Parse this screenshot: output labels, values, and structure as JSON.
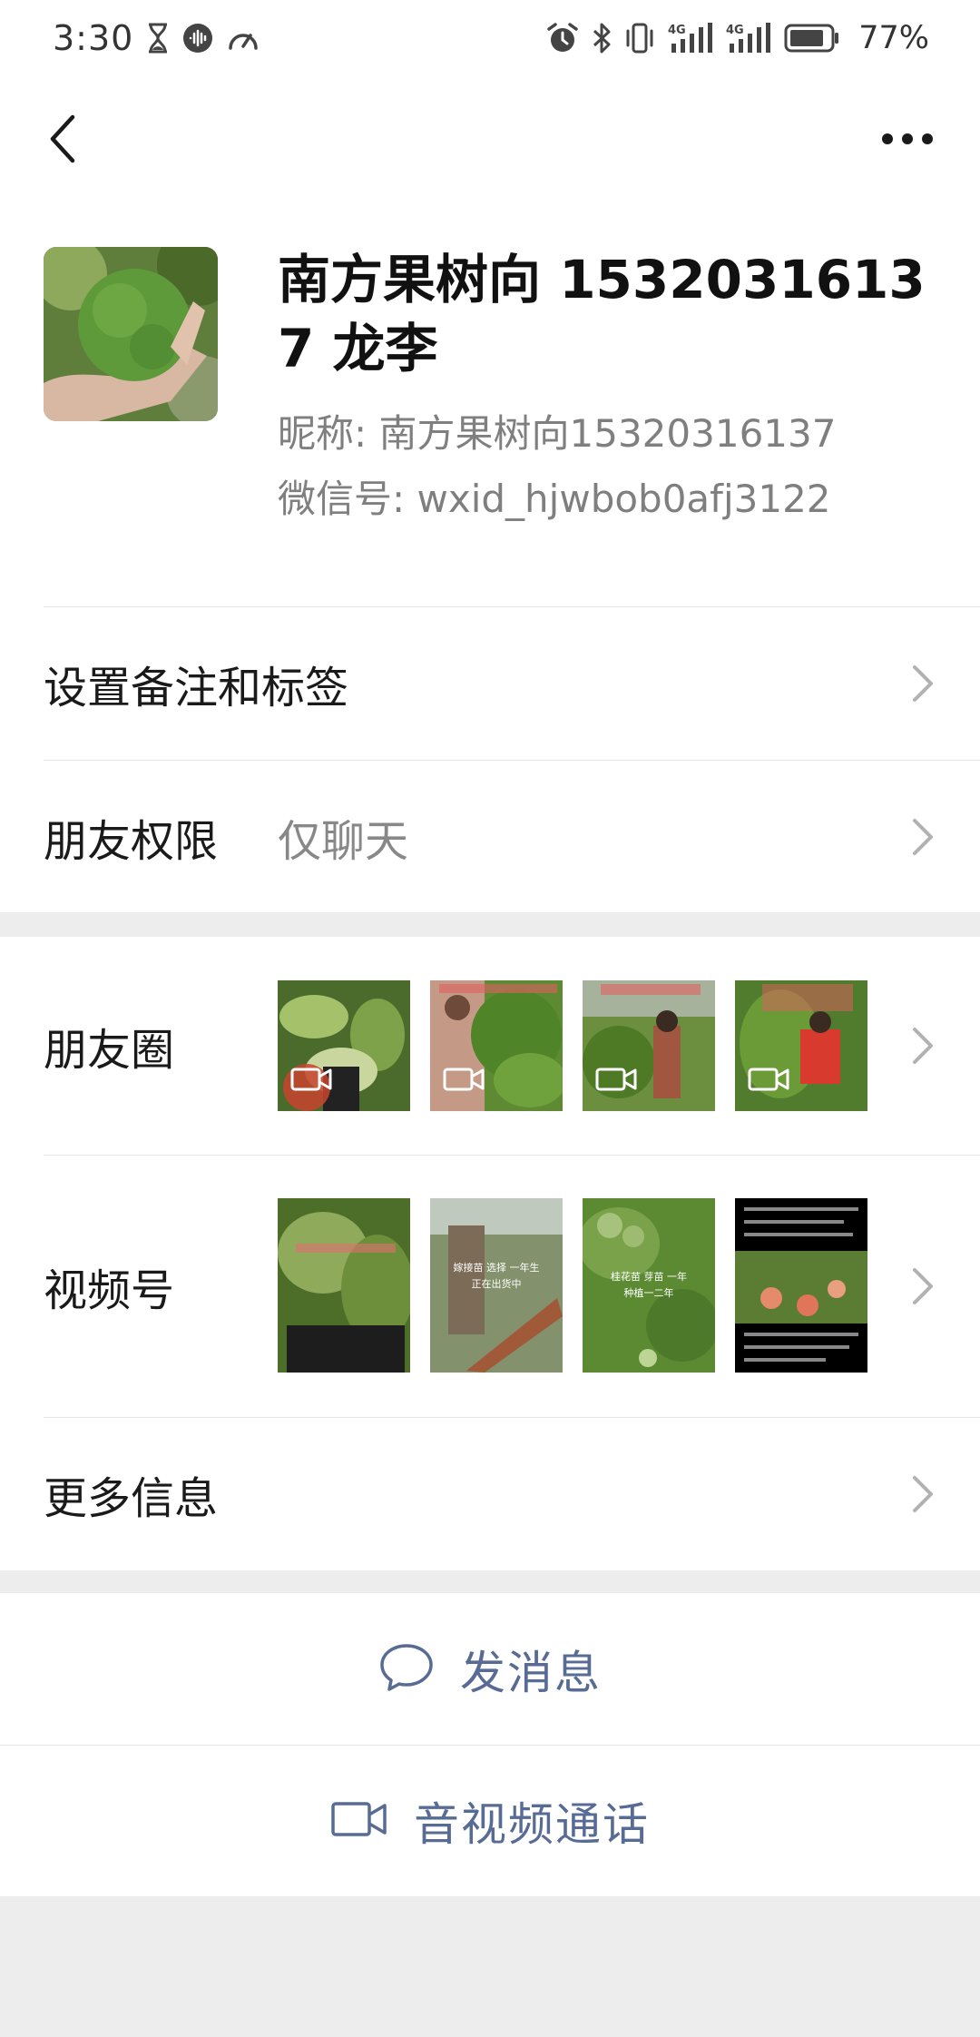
{
  "status_bar": {
    "time": "3:30",
    "battery": "77%",
    "network_badges": [
      "4G",
      "4G"
    ]
  },
  "nav": {
    "back_icon": "chevron-left-icon",
    "more_icon": "more-dots-icon"
  },
  "profile": {
    "display_name": "南方果树向 15320316137 龙李",
    "nickname_label": "昵称:",
    "nickname": "南方果树向15320316137",
    "wechat_id_label": "微信号:",
    "wechat_id": "wxid_hjwbob0afj3122"
  },
  "rows": {
    "remark_tags": "设置备注和标签",
    "friend_permissions": {
      "label": "朋友权限",
      "value": "仅聊天"
    },
    "moments": "朋友圈",
    "channels": "视频号",
    "more_info": "更多信息"
  },
  "channels_thumbs_text": [
    "",
    "嫁接苗 选择 一年生 正在出货中",
    "桂花苗 芽苗 一年 种植一二年",
    "晚熟蜜桃——脆红蜜桃。果期阳历8月中旬，比同类品种迟5-10天。单果重150克以上，果味浓，果肉脆甜，是做节日品种。"
  ],
  "actions": {
    "send_message": "发消息",
    "voice_video_call": "音视频通话"
  },
  "colors": {
    "link": "#576b95",
    "background": "#ededed",
    "card": "#ffffff"
  }
}
